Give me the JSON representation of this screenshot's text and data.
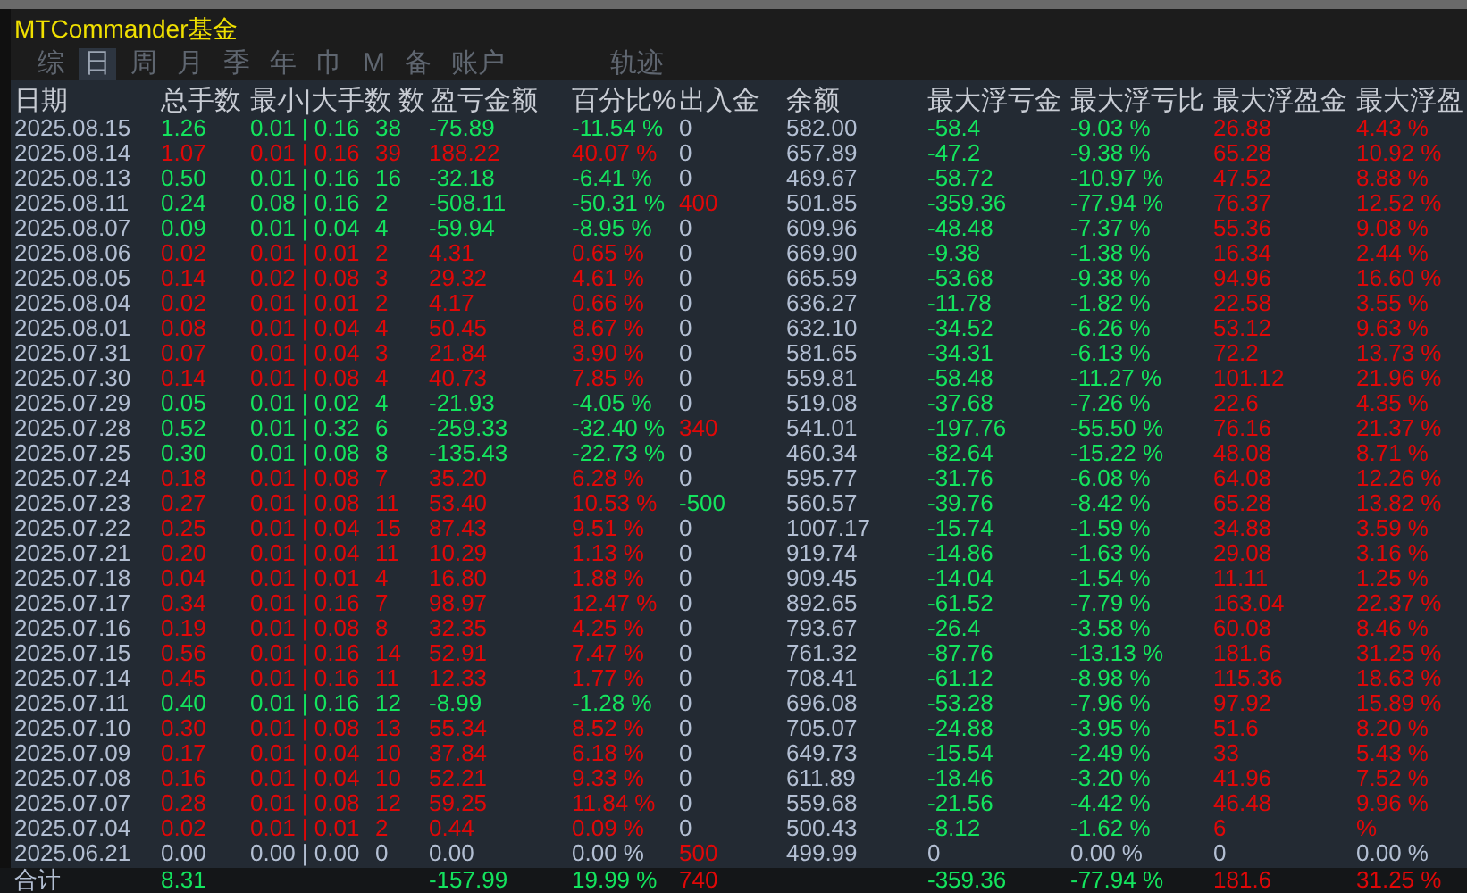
{
  "window": {
    "title": "MTCommander基金"
  },
  "tabs": [
    {
      "label": "综",
      "selected": false
    },
    {
      "label": "日",
      "selected": true
    },
    {
      "label": "周",
      "selected": false
    },
    {
      "label": "月",
      "selected": false
    },
    {
      "label": "季",
      "selected": false
    },
    {
      "label": "年",
      "selected": false
    },
    {
      "label": "巾",
      "selected": false
    },
    {
      "label": "M",
      "selected": false
    },
    {
      "label": "备",
      "selected": false
    },
    {
      "label": "账户",
      "selected": false
    },
    {
      "label": "轨迹",
      "selected": false
    }
  ],
  "table": {
    "columns": [
      "日期",
      "总手数",
      "最小|大手数",
      "数",
      "盈亏金额",
      "百分比%",
      "出入金",
      "余额",
      "最大浮亏金",
      "最大浮亏比",
      "最大浮盈金",
      "最大浮盈"
    ],
    "rows": [
      {
        "cells": [
          "2025.08.15",
          "1.26",
          "0.01 | 0.16",
          "38",
          "-75.89",
          "-11.54 %",
          "0",
          "582.00",
          "-58.4",
          "-9.03 %",
          "26.88",
          "4.43 %"
        ],
        "profit": false,
        "flat": false,
        "deposit": false,
        "withdrawal": false,
        "floating": true
      },
      {
        "cells": [
          "2025.08.14",
          "1.07",
          "0.01 | 0.16",
          "39",
          "188.22",
          "40.07 %",
          "0",
          "657.89",
          "-47.2",
          "-9.38 %",
          "65.28",
          "10.92 %"
        ],
        "profit": true,
        "flat": false,
        "deposit": false,
        "withdrawal": false,
        "floating": true
      },
      {
        "cells": [
          "2025.08.13",
          "0.50",
          "0.01 | 0.16",
          "16",
          "-32.18",
          "-6.41 %",
          "0",
          "469.67",
          "-58.72",
          "-10.97 %",
          "47.52",
          "8.88 %"
        ],
        "profit": false,
        "flat": false,
        "deposit": false,
        "withdrawal": false,
        "floating": true
      },
      {
        "cells": [
          "2025.08.11",
          "0.24",
          "0.08 | 0.16",
          "2",
          "-508.11",
          "-50.31 %",
          "400",
          "501.85",
          "-359.36",
          "-77.94 %",
          "76.37",
          "12.52 %"
        ],
        "profit": false,
        "flat": false,
        "deposit": true,
        "withdrawal": false,
        "floating": true
      },
      {
        "cells": [
          "2025.08.07",
          "0.09",
          "0.01 | 0.04",
          "4",
          "-59.94",
          "-8.95 %",
          "0",
          "609.96",
          "-48.48",
          "-7.37 %",
          "55.36",
          "9.08 %"
        ],
        "profit": false,
        "flat": false,
        "deposit": false,
        "withdrawal": false,
        "floating": true
      },
      {
        "cells": [
          "2025.08.06",
          "0.02",
          "0.01 | 0.01",
          "2",
          "4.31",
          "0.65 %",
          "0",
          "669.90",
          "-9.38",
          "-1.38 %",
          "16.34",
          "2.44 %"
        ],
        "profit": true,
        "flat": false,
        "deposit": false,
        "withdrawal": false,
        "floating": true
      },
      {
        "cells": [
          "2025.08.05",
          "0.14",
          "0.02 | 0.08",
          "3",
          "29.32",
          "4.61 %",
          "0",
          "665.59",
          "-53.68",
          "-9.38 %",
          "94.96",
          "16.60 %"
        ],
        "profit": true,
        "flat": false,
        "deposit": false,
        "withdrawal": false,
        "floating": true
      },
      {
        "cells": [
          "2025.08.04",
          "0.02",
          "0.01 | 0.01",
          "2",
          "4.17",
          "0.66 %",
          "0",
          "636.27",
          "-11.78",
          "-1.82 %",
          "22.58",
          "3.55 %"
        ],
        "profit": true,
        "flat": false,
        "deposit": false,
        "withdrawal": false,
        "floating": true
      },
      {
        "cells": [
          "2025.08.01",
          "0.08",
          "0.01 | 0.04",
          "4",
          "50.45",
          "8.67 %",
          "0",
          "632.10",
          "-34.52",
          "-6.26 %",
          "53.12",
          "9.63 %"
        ],
        "profit": true,
        "flat": false,
        "deposit": false,
        "withdrawal": false,
        "floating": true
      },
      {
        "cells": [
          "2025.07.31",
          "0.07",
          "0.01 | 0.04",
          "3",
          "21.84",
          "3.90 %",
          "0",
          "581.65",
          "-34.31",
          "-6.13 %",
          "72.2",
          "13.73 %"
        ],
        "profit": true,
        "flat": false,
        "deposit": false,
        "withdrawal": false,
        "floating": true
      },
      {
        "cells": [
          "2025.07.30",
          "0.14",
          "0.01 | 0.08",
          "4",
          "40.73",
          "7.85 %",
          "0",
          "559.81",
          "-58.48",
          "-11.27 %",
          "101.12",
          "21.96 %"
        ],
        "profit": true,
        "flat": false,
        "deposit": false,
        "withdrawal": false,
        "floating": true
      },
      {
        "cells": [
          "2025.07.29",
          "0.05",
          "0.01 | 0.02",
          "4",
          "-21.93",
          "-4.05 %",
          "0",
          "519.08",
          "-37.68",
          "-7.26 %",
          "22.6",
          "4.35 %"
        ],
        "profit": false,
        "flat": false,
        "deposit": false,
        "withdrawal": false,
        "floating": true
      },
      {
        "cells": [
          "2025.07.28",
          "0.52",
          "0.01 | 0.32",
          "6",
          "-259.33",
          "-32.40 %",
          "340",
          "541.01",
          "-197.76",
          "-55.50 %",
          "76.16",
          "21.37 %"
        ],
        "profit": false,
        "flat": false,
        "deposit": true,
        "withdrawal": false,
        "floating": true
      },
      {
        "cells": [
          "2025.07.25",
          "0.30",
          "0.01 | 0.08",
          "8",
          "-135.43",
          "-22.73 %",
          "0",
          "460.34",
          "-82.64",
          "-15.22 %",
          "48.08",
          "8.71 %"
        ],
        "profit": false,
        "flat": false,
        "deposit": false,
        "withdrawal": false,
        "floating": true
      },
      {
        "cells": [
          "2025.07.24",
          "0.18",
          "0.01 | 0.08",
          "7",
          "35.20",
          "6.28 %",
          "0",
          "595.77",
          "-31.76",
          "-6.08 %",
          "64.08",
          "12.26 %"
        ],
        "profit": true,
        "flat": false,
        "deposit": false,
        "withdrawal": false,
        "floating": true
      },
      {
        "cells": [
          "2025.07.23",
          "0.27",
          "0.01 | 0.08",
          "11",
          "53.40",
          "10.53 %",
          "-500",
          "560.57",
          "-39.76",
          "-8.42 %",
          "65.28",
          "13.82 %"
        ],
        "profit": true,
        "flat": false,
        "deposit": false,
        "withdrawal": true,
        "floating": true
      },
      {
        "cells": [
          "2025.07.22",
          "0.25",
          "0.01 | 0.04",
          "15",
          "87.43",
          "9.51 %",
          "0",
          "1007.17",
          "-15.74",
          "-1.59 %",
          "34.88",
          "3.59 %"
        ],
        "profit": true,
        "flat": false,
        "deposit": false,
        "withdrawal": false,
        "floating": true
      },
      {
        "cells": [
          "2025.07.21",
          "0.20",
          "0.01 | 0.04",
          "11",
          "10.29",
          "1.13 %",
          "0",
          "919.74",
          "-14.86",
          "-1.63 %",
          "29.08",
          "3.16 %"
        ],
        "profit": true,
        "flat": false,
        "deposit": false,
        "withdrawal": false,
        "floating": true
      },
      {
        "cells": [
          "2025.07.18",
          "0.04",
          "0.01 | 0.01",
          "4",
          "16.80",
          "1.88 %",
          "0",
          "909.45",
          "-14.04",
          "-1.54 %",
          "11.11",
          "1.25 %"
        ],
        "profit": true,
        "flat": false,
        "deposit": false,
        "withdrawal": false,
        "floating": true
      },
      {
        "cells": [
          "2025.07.17",
          "0.34",
          "0.01 | 0.16",
          "7",
          "98.97",
          "12.47 %",
          "0",
          "892.65",
          "-61.52",
          "-7.79 %",
          "163.04",
          "22.37 %"
        ],
        "profit": true,
        "flat": false,
        "deposit": false,
        "withdrawal": false,
        "floating": true
      },
      {
        "cells": [
          "2025.07.16",
          "0.19",
          "0.01 | 0.08",
          "8",
          "32.35",
          "4.25 %",
          "0",
          "793.67",
          "-26.4",
          "-3.58 %",
          "60.08",
          "8.46 %"
        ],
        "profit": true,
        "flat": false,
        "deposit": false,
        "withdrawal": false,
        "floating": true
      },
      {
        "cells": [
          "2025.07.15",
          "0.56",
          "0.01 | 0.16",
          "14",
          "52.91",
          "7.47 %",
          "0",
          "761.32",
          "-87.76",
          "-13.13 %",
          "181.6",
          "31.25 %"
        ],
        "profit": true,
        "flat": false,
        "deposit": false,
        "withdrawal": false,
        "floating": true
      },
      {
        "cells": [
          "2025.07.14",
          "0.45",
          "0.01 | 0.16",
          "11",
          "12.33",
          "1.77 %",
          "0",
          "708.41",
          "-61.12",
          "-8.98 %",
          "115.36",
          "18.63 %"
        ],
        "profit": true,
        "flat": false,
        "deposit": false,
        "withdrawal": false,
        "floating": true
      },
      {
        "cells": [
          "2025.07.11",
          "0.40",
          "0.01 | 0.16",
          "12",
          "-8.99",
          "-1.28 %",
          "0",
          "696.08",
          "-53.28",
          "-7.96 %",
          "97.92",
          "15.89 %"
        ],
        "profit": false,
        "flat": false,
        "deposit": false,
        "withdrawal": false,
        "floating": true
      },
      {
        "cells": [
          "2025.07.10",
          "0.30",
          "0.01 | 0.08",
          "13",
          "55.34",
          "8.52 %",
          "0",
          "705.07",
          "-24.88",
          "-3.95 %",
          "51.6",
          "8.20 %"
        ],
        "profit": true,
        "flat": false,
        "deposit": false,
        "withdrawal": false,
        "floating": true
      },
      {
        "cells": [
          "2025.07.09",
          "0.17",
          "0.01 | 0.04",
          "10",
          "37.84",
          "6.18 %",
          "0",
          "649.73",
          "-15.54",
          "-2.49 %",
          "33",
          "5.43 %"
        ],
        "profit": true,
        "flat": false,
        "deposit": false,
        "withdrawal": false,
        "floating": true
      },
      {
        "cells": [
          "2025.07.08",
          "0.16",
          "0.01 | 0.04",
          "10",
          "52.21",
          "9.33 %",
          "0",
          "611.89",
          "-18.46",
          "-3.20 %",
          "41.96",
          "7.52 %"
        ],
        "profit": true,
        "flat": false,
        "deposit": false,
        "withdrawal": false,
        "floating": true
      },
      {
        "cells": [
          "2025.07.07",
          "0.28",
          "0.01 | 0.08",
          "12",
          "59.25",
          "11.84 %",
          "0",
          "559.68",
          "-21.56",
          "-4.42 %",
          "46.48",
          "9.96 %"
        ],
        "profit": true,
        "flat": false,
        "deposit": false,
        "withdrawal": false,
        "floating": true
      },
      {
        "cells": [
          "2025.07.04",
          "0.02",
          "0.01 | 0.01",
          "2",
          "0.44",
          "0.09 %",
          "0",
          "500.43",
          "-8.12",
          "-1.62 %",
          "6",
          "%"
        ],
        "profit": true,
        "flat": false,
        "deposit": false,
        "withdrawal": false,
        "floating": true
      },
      {
        "cells": [
          "2025.06.21",
          "0.00",
          "0.00 | 0.00",
          "0",
          "0.00",
          "0.00 %",
          "500",
          "499.99",
          "0",
          "0.00 %",
          "0",
          "0.00 %"
        ],
        "profit": false,
        "flat": true,
        "deposit": true,
        "withdrawal": false,
        "floating": false
      }
    ],
    "total": {
      "cells": [
        "合计",
        "8.31",
        "",
        "",
        "-157.99",
        "19.99 %",
        "740",
        "",
        "-359.36",
        "-77.94 %",
        "181.6",
        "31.25 %"
      ],
      "profit": false,
      "flat": false,
      "deposit": true,
      "withdrawal": false,
      "floating": true
    }
  }
}
